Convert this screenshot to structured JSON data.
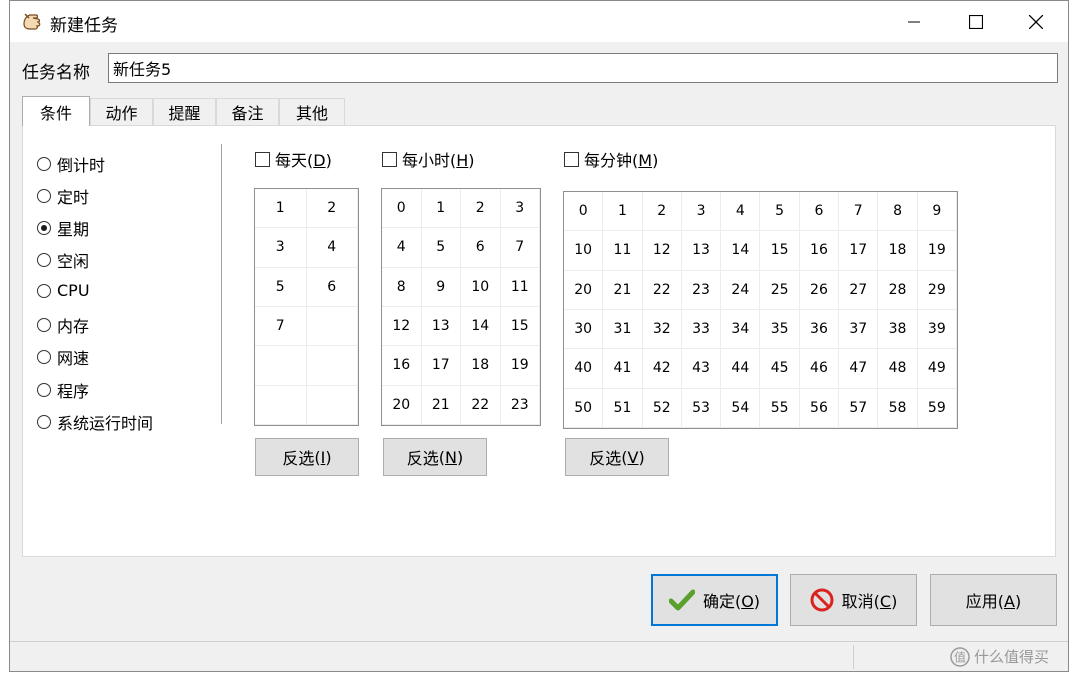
{
  "window": {
    "title": "新建任务",
    "app_icon": "hand-icon",
    "controls": [
      "minimize-icon",
      "maximize-icon",
      "close-icon"
    ]
  },
  "task_name": {
    "label": "任务名称",
    "value": "新任务5"
  },
  "tabs": [
    {
      "label": "条件",
      "active": true
    },
    {
      "label": "动作",
      "active": false
    },
    {
      "label": "提醒",
      "active": false
    },
    {
      "label": "备注",
      "active": false
    },
    {
      "label": "其他",
      "active": false
    }
  ],
  "conditions": {
    "selected": "星期",
    "options": [
      "倒计时",
      "定时",
      "星期",
      "空闲",
      "CPU",
      "内存",
      "网速",
      "程序",
      "系统运行时间"
    ]
  },
  "week": {
    "checkbox_label": "每天",
    "checkbox_key": "D",
    "checked": false,
    "cells": [
      "1",
      "2",
      "3",
      "4",
      "5",
      "6",
      "7",
      "",
      "",
      "",
      "",
      ""
    ],
    "invert_label": "反选",
    "invert_key": "I"
  },
  "hour": {
    "checkbox_label": "每小时",
    "checkbox_key": "H",
    "checked": false,
    "cells": [
      "0",
      "1",
      "2",
      "3",
      "4",
      "5",
      "6",
      "7",
      "8",
      "9",
      "10",
      "11",
      "12",
      "13",
      "14",
      "15",
      "16",
      "17",
      "18",
      "19",
      "20",
      "21",
      "22",
      "23"
    ],
    "invert_label": "反选",
    "invert_key": "N"
  },
  "minute": {
    "checkbox_label": "每分钟",
    "checkbox_key": "M",
    "checked": false,
    "cells": [
      "0",
      "1",
      "2",
      "3",
      "4",
      "5",
      "6",
      "7",
      "8",
      "9",
      "10",
      "11",
      "12",
      "13",
      "14",
      "15",
      "16",
      "17",
      "18",
      "19",
      "20",
      "21",
      "22",
      "23",
      "24",
      "25",
      "26",
      "27",
      "28",
      "29",
      "30",
      "31",
      "32",
      "33",
      "34",
      "35",
      "36",
      "37",
      "38",
      "39",
      "40",
      "41",
      "42",
      "43",
      "44",
      "45",
      "46",
      "47",
      "48",
      "49",
      "50",
      "51",
      "52",
      "53",
      "54",
      "55",
      "56",
      "57",
      "58",
      "59"
    ],
    "invert_label": "反选",
    "invert_key": "V"
  },
  "buttons": {
    "ok": {
      "label": "确定",
      "key": "O",
      "icon": "checkmark-icon"
    },
    "cancel": {
      "label": "取消",
      "key": "C",
      "icon": "prohibited-icon"
    },
    "apply": {
      "label": "应用",
      "key": "A"
    }
  },
  "watermark": {
    "text": "什么值得买",
    "icon": "zhi-logo-icon"
  },
  "colors": {
    "accent": "#0078d7",
    "check_green": "#5aa02c",
    "cancel_red": "#d9231c"
  }
}
